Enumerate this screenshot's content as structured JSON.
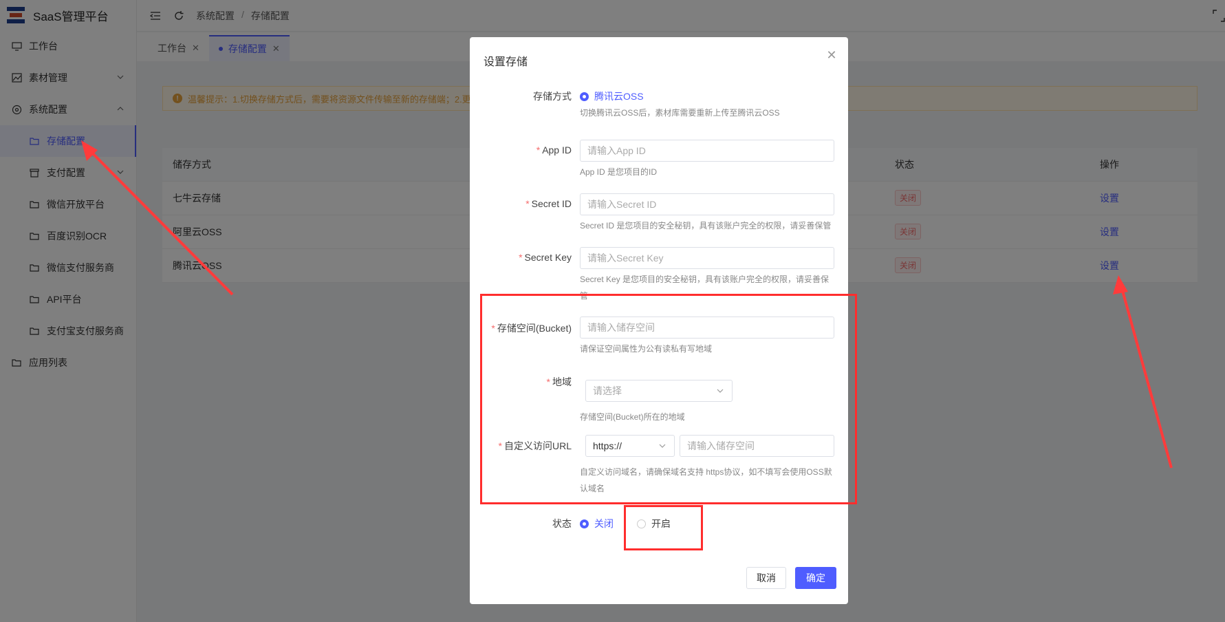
{
  "app": {
    "title": "SaaS管理平台"
  },
  "sidebar": {
    "items": [
      {
        "label": "工作台"
      },
      {
        "label": "素材管理"
      },
      {
        "label": "系统配置"
      },
      {
        "label": "存储配置"
      },
      {
        "label": "支付配置"
      },
      {
        "label": "微信开放平台"
      },
      {
        "label": "百度识别OCR"
      },
      {
        "label": "微信支付服务商"
      },
      {
        "label": "API平台"
      },
      {
        "label": "支付宝支付服务商"
      },
      {
        "label": "应用列表"
      }
    ]
  },
  "header": {
    "breadcrumb": [
      "系统配置",
      "存储配置"
    ],
    "separator": "/"
  },
  "tabs": [
    {
      "label": "工作台"
    },
    {
      "label": "存储配置"
    }
  ],
  "alert": {
    "text": "温馨提示：1.切换存储方式后，需要将资源文件传输至新的存储端；2.更"
  },
  "table": {
    "headers": [
      "储存方式",
      "状态",
      "操作"
    ],
    "rows": [
      {
        "name": "七牛云存储",
        "status": "关闭",
        "action": "设置"
      },
      {
        "name": "阿里云OSS",
        "status": "关闭",
        "action": "设置"
      },
      {
        "name": "腾讯云OSS",
        "status": "关闭",
        "action": "设置"
      }
    ]
  },
  "modal": {
    "title": "设置存储",
    "storage_type": {
      "label": "存储方式",
      "option": "腾讯云OSS",
      "hint": "切换腾讯云OSS后，素材库需要重新上传至腾讯云OSS"
    },
    "app_id": {
      "label": "App ID",
      "placeholder": "请输入App ID",
      "hint": "App ID 是您项目的ID"
    },
    "secret_id": {
      "label": "Secret ID",
      "placeholder": "请输入Secret ID",
      "hint": "Secret ID 是您项目的安全秘钥，具有该账户完全的权限，请妥善保管"
    },
    "secret_key": {
      "label": "Secret Key",
      "placeholder": "请输入Secret Key",
      "hint": "Secret Key 是您项目的安全秘钥，具有该账户完全的权限，请妥善保管"
    },
    "bucket": {
      "label": "存储空间(Bucket)",
      "placeholder": "请输入储存空间",
      "hint": "请保证空间属性为公有读私有写地域"
    },
    "region": {
      "label": "地域",
      "placeholder": "请选择",
      "hint": "存储空间(Bucket)所在的地域"
    },
    "custom_url": {
      "label": "自定义访问URL",
      "protocol": "https://",
      "placeholder": "请输入储存空间",
      "hint": "自定义访问域名，请确保域名支持 https协议，如不填写会使用OSS默认域名"
    },
    "status": {
      "label": "状态",
      "off": "关闭",
      "on": "开启"
    },
    "cancel_label": "取消",
    "ok_label": "确定"
  },
  "colors": {
    "accent": "#4f5dff",
    "annotation": "#ff2d2d",
    "required": "#f56c6c"
  }
}
